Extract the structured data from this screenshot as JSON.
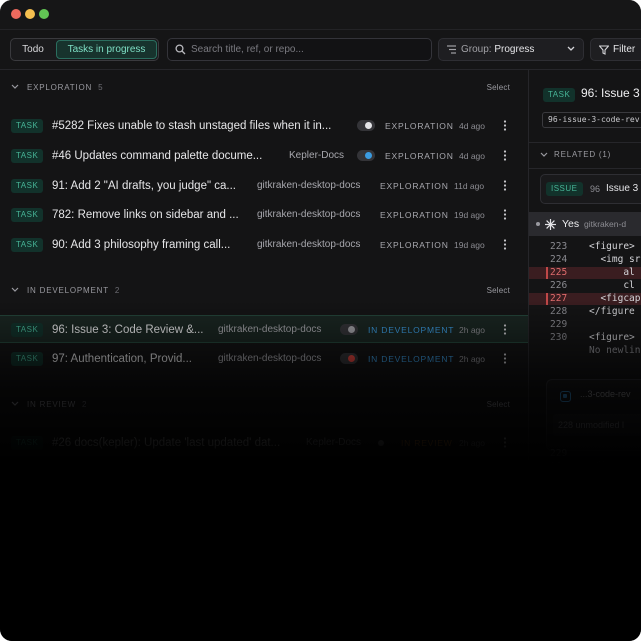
{
  "window": {
    "dots": [
      "#ed6a5e",
      "#f5bf4f",
      "#62c554"
    ]
  },
  "toolbar": {
    "tab_todo": "Todo",
    "tab_active": "Tasks in progress",
    "search_placeholder": "Search title, ref, or repo...",
    "group_label": "Group:",
    "group_value": "Progress",
    "filter_label": "Filter"
  },
  "colors": {
    "accent": "#47b597",
    "exploration": "#a8a8ae",
    "in_development": "#3b9be0",
    "in_review": "#d9822b"
  },
  "sections": [
    {
      "title": "EXPLORATION",
      "count": "5",
      "select": "Select",
      "rows": [
        {
          "badge": "TASK",
          "title": "#5282 Fixes unable to stash unstaged files when it in...",
          "repo": "",
          "status": "EXPLORATION",
          "age": "4d ago",
          "toggle": "off"
        },
        {
          "badge": "TASK",
          "title": "#46 Updates command palette docume...",
          "repo": "Kepler-Docs",
          "status": "EXPLORATION",
          "age": "4d ago",
          "toggle": "on"
        },
        {
          "badge": "TASK",
          "title": "91: Add 2 \"AI drafts, you judge\" ca...",
          "repo": "gitkraken-desktop-docs",
          "status": "EXPLORATION",
          "age": "11d ago",
          "toggle": "none"
        },
        {
          "badge": "TASK",
          "title": "782: Remove links on sidebar and ...",
          "repo": "gitkraken-desktop-docs",
          "status": "EXPLORATION",
          "age": "19d ago",
          "toggle": "none"
        },
        {
          "badge": "TASK",
          "title": "90: Add 3 philosophy framing call...",
          "repo": "gitkraken-desktop-docs",
          "status": "EXPLORATION",
          "age": "19d ago",
          "toggle": "none"
        }
      ]
    },
    {
      "title": "IN DEVELOPMENT",
      "count": "2",
      "select": "Select",
      "rows": [
        {
          "badge": "TASK",
          "title": "96: Issue 3: Code Review &...",
          "repo": "gitkraken-desktop-docs",
          "status": "IN DEVELOPMENT",
          "age": "2h ago",
          "toggle": "off"
        },
        {
          "badge": "TASK",
          "title": "97: Authentication, Provid...",
          "repo": "gitkraken-desktop-docs",
          "status": "IN DEVELOPMENT",
          "age": "2h ago",
          "toggle": "red"
        }
      ]
    },
    {
      "title": "IN REVIEW",
      "count": "2",
      "select": "Select",
      "rows": [
        {
          "badge": "TASK",
          "title": "#26 docs(kepler): Update 'last updated' dat...",
          "repo": "Kepler-Docs",
          "status": "IN REVIEW",
          "age": "2h ago",
          "toggle": "dot"
        },
        {
          "badge": "",
          "title": "Perform an audit of the",
          "repo": "",
          "status": "",
          "age": "",
          "toggle": "none"
        }
      ]
    }
  ],
  "detail": {
    "badge": "TASK",
    "title": "96: Issue 3",
    "branch": "96-issue-3-code-rev",
    "related_label": "RELATED (1)",
    "related_badge": "ISSUE",
    "related_num": "96",
    "related_title": "Issue 3",
    "yes_label": "Yes",
    "yes_repo": "gitkraken-d",
    "code_lines": [
      {
        "n": "223",
        "t": "<figure>",
        "del": false
      },
      {
        "n": "224",
        "t": "  <img sr",
        "del": false
      },
      {
        "n": "225",
        "t": "      al",
        "del": true
      },
      {
        "n": "226",
        "t": "      cl",
        "del": false
      },
      {
        "n": "227",
        "t": "  <figcap",
        "del": true
      },
      {
        "n": "228",
        "t": "</figure",
        "del": false
      },
      {
        "n": "229",
        "t": "",
        "del": false
      },
      {
        "n": "230",
        "t": "<figure>",
        "del": false
      }
    ],
    "no_newline": "No newlin",
    "card_branch": "...3-code-rev",
    "unmodified": "228 unmodified l",
    "tail_lines": [
      {
        "n": "229",
        "t": ""
      },
      {
        "n": "230",
        "t": "<figure"
      }
    ]
  }
}
